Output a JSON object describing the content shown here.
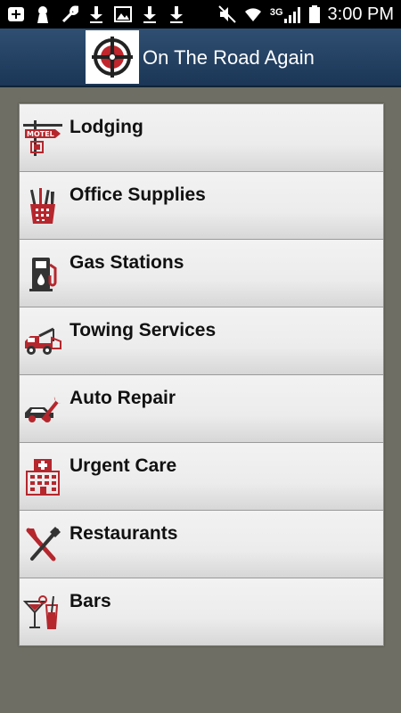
{
  "status_bar": {
    "time": "3:00 PM",
    "network": "3G",
    "left_icons": [
      "add-icon",
      "keyhole-icon",
      "wrench-icon",
      "download-icon",
      "image-icon",
      "download-icon",
      "download-icon"
    ],
    "right_icons": [
      "mute-icon",
      "wifi-icon",
      "signal-icon",
      "battery-icon"
    ]
  },
  "header": {
    "title": "On The Road Again",
    "logo_icon": "compass-logo"
  },
  "categories": [
    {
      "label": "Lodging",
      "icon": "motel-icon"
    },
    {
      "label": "Office Supplies",
      "icon": "office-supplies-icon"
    },
    {
      "label": "Gas Stations",
      "icon": "gas-pump-icon"
    },
    {
      "label": "Towing Services",
      "icon": "tow-truck-icon"
    },
    {
      "label": "Auto Repair",
      "icon": "car-wrench-icon"
    },
    {
      "label": "Urgent Care",
      "icon": "hospital-icon"
    },
    {
      "label": "Restaurants",
      "icon": "fork-knife-icon"
    },
    {
      "label": "Bars",
      "icon": "cocktail-icon"
    }
  ],
  "colors": {
    "header": "#1b3656",
    "background": "#6e6e64",
    "icon_red": "#b5272d",
    "icon_dark": "#333333"
  }
}
